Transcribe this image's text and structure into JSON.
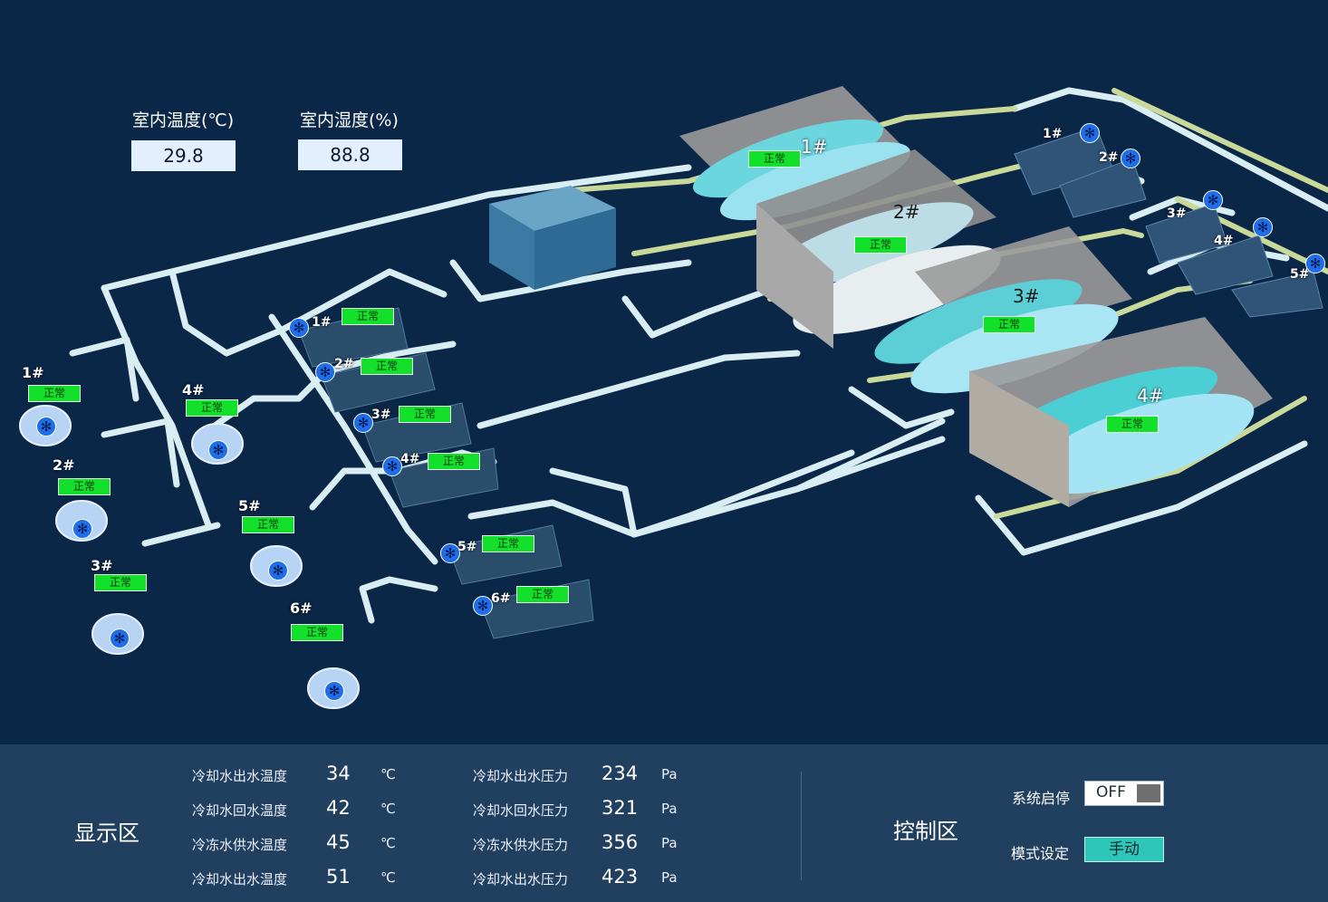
{
  "environment": {
    "indoor_temp_label": "室内温度(℃)",
    "indoor_temp_value": "29.8",
    "indoor_humidity_label": "室内湿度(%)",
    "indoor_humidity_value": "88.8"
  },
  "status_text": "正常",
  "chillers": [
    {
      "id": "1#",
      "status": "正常"
    },
    {
      "id": "2#",
      "status": "正常"
    },
    {
      "id": "3#",
      "status": "正常"
    },
    {
      "id": "4#",
      "status": "正常"
    }
  ],
  "cooling_pumps": [
    {
      "id": "1#",
      "status": "正常"
    },
    {
      "id": "2#",
      "status": "正常"
    },
    {
      "id": "3#",
      "status": "正常"
    },
    {
      "id": "4#",
      "status": "正常"
    },
    {
      "id": "5#",
      "status": "正常"
    },
    {
      "id": "6#",
      "status": "正常"
    }
  ],
  "middle_pumps": [
    {
      "id": "1#",
      "status": "正常"
    },
    {
      "id": "2#",
      "status": "正常"
    },
    {
      "id": "3#",
      "status": "正常"
    },
    {
      "id": "4#",
      "status": "正常"
    },
    {
      "id": "5#",
      "status": "正常"
    },
    {
      "id": "6#",
      "status": "正常"
    }
  ],
  "tower_fans": [
    "1#",
    "2#",
    "3#",
    "4#",
    "5#"
  ],
  "display_zone": {
    "title": "显示区",
    "temperatures": [
      {
        "label": "冷却水出水温度",
        "value": "34",
        "unit": "℃"
      },
      {
        "label": "冷却水回水温度",
        "value": "42",
        "unit": "℃"
      },
      {
        "label": "冷冻水供水温度",
        "value": "45",
        "unit": "℃"
      },
      {
        "label": "冷却水出水温度",
        "value": "51",
        "unit": "℃"
      }
    ],
    "pressures": [
      {
        "label": "冷却水出水压力",
        "value": "234",
        "unit": "Pa"
      },
      {
        "label": "冷却水回水压力",
        "value": "321",
        "unit": "Pa"
      },
      {
        "label": "冷冻水供水压力",
        "value": "356",
        "unit": "Pa"
      },
      {
        "label": "冷却水出水压力",
        "value": "423",
        "unit": "Pa"
      }
    ]
  },
  "control_zone": {
    "title": "控制区",
    "system_label": "系统启停",
    "system_state": "OFF",
    "mode_label": "模式设定",
    "mode_value": "手动"
  },
  "colors": {
    "background": "#0b2748",
    "panel": "#213f5e",
    "status_ok": "#12e02a",
    "fan_blue": "#1d6ee8",
    "mode_button": "#2ec6b8"
  }
}
